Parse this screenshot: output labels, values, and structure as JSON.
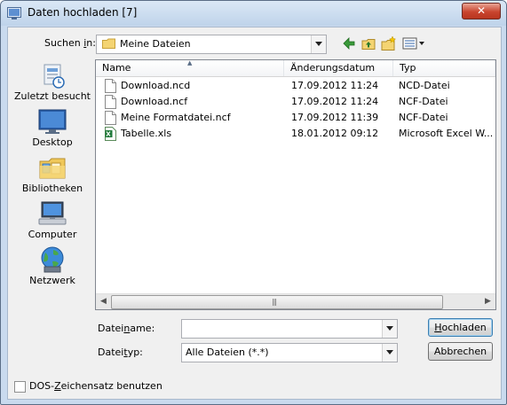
{
  "window": {
    "title": "Daten hochladen [7]",
    "close_glyph": "✕"
  },
  "lookin": {
    "label_pre": "Suchen ",
    "label_ul": "i",
    "label_post": "n:",
    "value": "Meine Dateien"
  },
  "places": [
    {
      "label": "Zuletzt besucht",
      "icon": "recent-places-icon"
    },
    {
      "label": "Desktop",
      "icon": "desktop-icon"
    },
    {
      "label": "Bibliotheken",
      "icon": "libraries-icon"
    },
    {
      "label": "Computer",
      "icon": "computer-icon"
    },
    {
      "label": "Netzwerk",
      "icon": "network-icon"
    }
  ],
  "columns": {
    "name": "Name",
    "date": "Änderungsdatum",
    "type": "Typ"
  },
  "files": [
    {
      "name": "Download.ncd",
      "date": "17.09.2012 11:24",
      "type": "NCD-Datei",
      "icon": "generic-file-icon"
    },
    {
      "name": "Download.ncf",
      "date": "17.09.2012 11:24",
      "type": "NCF-Datei",
      "icon": "generic-file-icon"
    },
    {
      "name": "Meine Formatdatei.ncf",
      "date": "17.09.2012 11:39",
      "type": "NCF-Datei",
      "icon": "generic-file-icon"
    },
    {
      "name": "Tabelle.xls",
      "date": "18.01.2012 09:12",
      "type": "Microsoft Excel W...",
      "icon": "excel-file-icon"
    }
  ],
  "filename": {
    "label_pre": "Datei",
    "label_ul": "n",
    "label_post": "ame:",
    "value": ""
  },
  "filetype": {
    "label_pre": "Datei",
    "label_ul": "t",
    "label_post": "yp:",
    "value": "Alle Dateien (*.*)"
  },
  "buttons": {
    "upload_ul": "H",
    "upload_rest": "ochladen",
    "cancel": "Abbrechen"
  },
  "checkbox": {
    "label_pre": "DOS-",
    "label_ul": "Z",
    "label_post": "eichensatz benutzen",
    "checked": false
  },
  "colors": {
    "title_bar": "#bfd3ea",
    "close_button": "#c9452f",
    "dialog_bg": "#f0f0f0"
  }
}
